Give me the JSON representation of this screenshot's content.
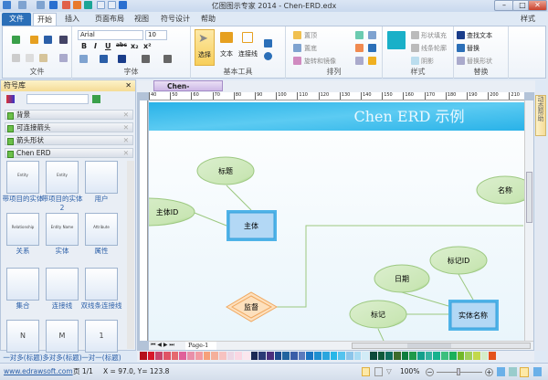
{
  "window": {
    "title": "亿图图示专家 2014 - Chen-ERD.edx",
    "minimize": "–",
    "maximize": "□",
    "close": "✕"
  },
  "tabs": [
    {
      "label": "文件"
    },
    {
      "label": "开始"
    },
    {
      "label": "插入"
    },
    {
      "label": "页面布局"
    },
    {
      "label": "视图"
    },
    {
      "label": "符号设计"
    },
    {
      "label": "帮助"
    }
  ],
  "style_menu": "样式",
  "ribbon": {
    "file_group": "文件",
    "font_group": "字体",
    "font_name": "Arial",
    "font_size": "10",
    "font_buttons": [
      "B",
      "I",
      "U",
      "abc",
      "x₂",
      "x²"
    ],
    "tools_group": "基本工具",
    "select": "选择",
    "text": "文本",
    "connector": "连接线",
    "arrange_group": "排列",
    "bring_front": "置顶",
    "send_back": "置底",
    "rotate": "旋转和镜像",
    "style_group": "样式",
    "fill": "形状填充",
    "line": "线条轮廓",
    "shadow": "阴影",
    "replace_group": "替换",
    "find": "查找文本",
    "replace": "替换",
    "replace_shape": "替换形状"
  },
  "library": {
    "title": "符号库",
    "categories": [
      "背景",
      "可连接箭头",
      "箭头形状",
      "Chen ERD"
    ],
    "shapes": [
      {
        "label": "带项目的实体",
        "inner": "Entity"
      },
      {
        "label": "带项目的实体 2",
        "inner": "Entity"
      },
      {
        "label": "用户"
      },
      {
        "label": "关系",
        "inner": "Relationship"
      },
      {
        "label": "实体",
        "inner": "Entity Name"
      },
      {
        "label": "属性",
        "inner": "Attribute"
      },
      {
        "label": "集合"
      },
      {
        "label": "连接线"
      },
      {
        "label": "双线条连接线"
      },
      {
        "label": "一对多(标题)",
        "inner": "N"
      },
      {
        "label": "多对多(标题)",
        "inner": "M"
      },
      {
        "label": "一对一(标题)",
        "inner": "1"
      }
    ]
  },
  "document": {
    "tab": "Chen-ERD.edx",
    "page_tab": "Page-1",
    "help_panel": "动态帮助",
    "ruler_h": [
      "40",
      "50",
      "60",
      "70",
      "80",
      "90",
      "100",
      "110",
      "120",
      "130",
      "140",
      "150",
      "160",
      "170",
      "180",
      "190",
      "200",
      "210"
    ],
    "diagram": {
      "title": "Chen ERD 示例",
      "entities": [
        "主体",
        "实体名称"
      ],
      "relationship": "监督",
      "attributes": [
        "标题",
        "主体ID",
        "名称",
        "日期",
        "标记ID",
        "标记"
      ]
    }
  },
  "palette": [
    "#b5121b",
    "#d7182a",
    "#c8456b",
    "#e05366",
    "#e56a6f",
    "#e0609a",
    "#e98fa9",
    "#f29ba3",
    "#f7a07a",
    "#f5b09b",
    "#f7c2c0",
    "#ecd6e4",
    "#fad7e3",
    "#fbe7ee",
    "#1b2a55",
    "#2b3a75",
    "#4a2f7d",
    "#1c4a8d",
    "#21639f",
    "#3a5ea8",
    "#5a7bbd",
    "#1a75c2",
    "#1f8fd0",
    "#2ba6de",
    "#27b7e8",
    "#55c3ee",
    "#8cc5ea",
    "#a8dbf3",
    "#d2ecf7",
    "#0c4a3a",
    "#0f5a3a",
    "#0e6d5c",
    "#3d6b2b",
    "#0f7d3f",
    "#1f9a4a",
    "#14a08c",
    "#34b3a0",
    "#17b28e",
    "#3cbf7d",
    "#1cb05b",
    "#72b82a",
    "#a0cf5b",
    "#c2d84b",
    "#d5eec9",
    "#e4521b"
  ],
  "status": {
    "link": "www.edrawsoft.com",
    "page": "页 1/1",
    "coords": "X = 97.0, Y= 123.8",
    "zoom": "100%"
  }
}
